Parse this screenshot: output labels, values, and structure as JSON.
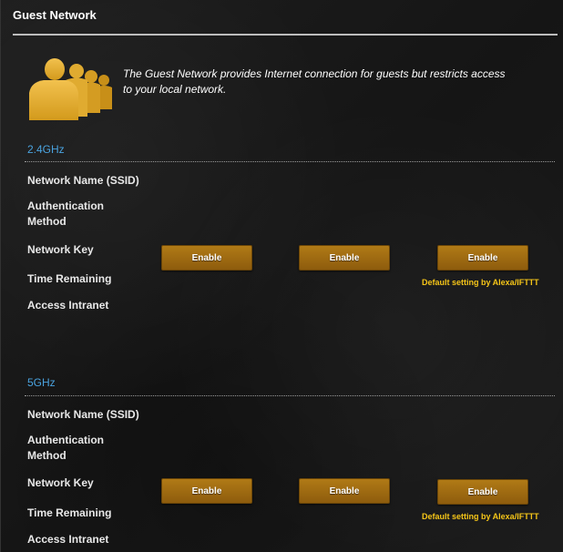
{
  "header": {
    "title": "Guest Network"
  },
  "intro": {
    "description": "The Guest Network provides Internet connection for guests but restricts access to your local network."
  },
  "bands": [
    {
      "title": "2.4GHz",
      "labels": {
        "ssid": "Network Name (SSID)",
        "auth": "Authentication Method",
        "key": "Network Key",
        "time": "Time Remaining",
        "intranet": "Access Intranet"
      },
      "buttons": [
        "Enable",
        "Enable",
        "Enable"
      ],
      "note": "Default setting by Alexa/IFTTT"
    },
    {
      "title": "5GHz",
      "labels": {
        "ssid": "Network Name (SSID)",
        "auth": "Authentication Method",
        "key": "Network Key",
        "time": "Time Remaining",
        "intranet": "Access Intranet"
      },
      "buttons": [
        "Enable",
        "Enable",
        "Enable"
      ],
      "note": "Default setting by Alexa/IFTTT"
    }
  ],
  "colors": {
    "accent": "#4aa3df",
    "button": "#9c6a10",
    "note": "#f5c518"
  },
  "icons": {
    "guest": "guest-users-icon"
  }
}
